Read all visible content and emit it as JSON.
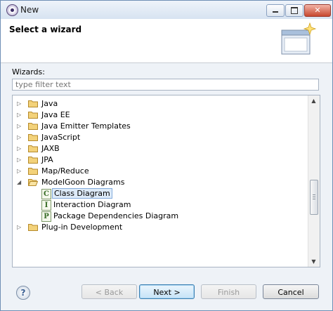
{
  "window": {
    "title": "New"
  },
  "banner": {
    "title": "Select a wizard"
  },
  "wizards": {
    "label": "Wizards:",
    "filter_placeholder": "type filter text",
    "filter_value": ""
  },
  "tree": {
    "items": [
      {
        "label": "Java",
        "type": "folder",
        "expanded": false
      },
      {
        "label": "Java EE",
        "type": "folder",
        "expanded": false
      },
      {
        "label": "Java Emitter Templates",
        "type": "folder",
        "expanded": false
      },
      {
        "label": "JavaScript",
        "type": "folder",
        "expanded": false
      },
      {
        "label": "JAXB",
        "type": "folder",
        "expanded": false
      },
      {
        "label": "JPA",
        "type": "folder",
        "expanded": false
      },
      {
        "label": "Map/Reduce",
        "type": "folder",
        "expanded": false
      },
      {
        "label": "ModelGoon Diagrams",
        "type": "folder",
        "expanded": true
      },
      {
        "label": "Class Diagram",
        "type": "leaf",
        "icon_letter": "C",
        "selected": true
      },
      {
        "label": "Interaction Diagram",
        "type": "leaf",
        "icon_letter": "I"
      },
      {
        "label": "Package Dependencies Diagram",
        "type": "leaf",
        "icon_letter": "P"
      },
      {
        "label": "Plug-in Development",
        "type": "folder",
        "expanded": false
      }
    ]
  },
  "buttons": {
    "back": "< Back",
    "next": "Next >",
    "finish": "Finish",
    "cancel": "Cancel",
    "help": "?"
  },
  "colors": {
    "folder_fill": "#f3d27a",
    "folder_stroke": "#b58a2c",
    "selection": "#ddeaf8"
  }
}
